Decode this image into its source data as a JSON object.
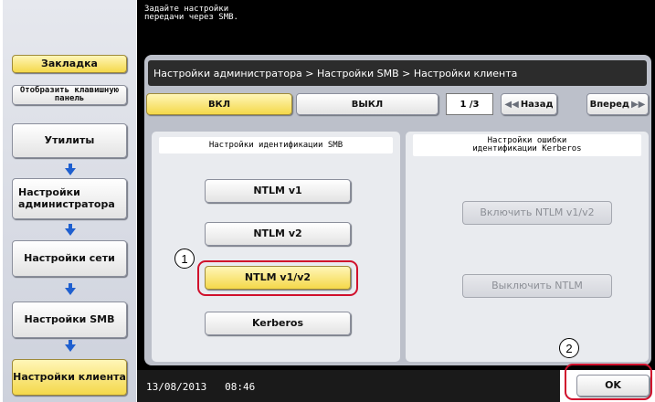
{
  "sidebar": {
    "bookmark": "Закладка",
    "show_keypad": "Отобразить клавишную панель",
    "steps": [
      "Утилиты",
      "Настройки администратора",
      "Настройки сети",
      "Настройки SMB",
      "Настройки клиента"
    ]
  },
  "message": "Задайте настройки\nпередачи через SMB.",
  "breadcrumb": "Настройки администратора > Настройки SMB > Настройки клиента",
  "toggle": {
    "on": "ВКЛ",
    "off": "ВЫКЛ"
  },
  "pager": {
    "indicator": "1 /3",
    "back": "Назад",
    "forward": "Вперед"
  },
  "auth_panel": {
    "title": "Настройки идентификации SMB",
    "options": [
      "NTLM v1",
      "NTLM v2",
      "NTLM v1/v2",
      "Kerberos"
    ],
    "selected": "NTLM v1/v2"
  },
  "kerberos_panel": {
    "title": "Настройки ошибки\nидентификации Kerberos",
    "enable_ntlm": "Включить NTLM v1/v2",
    "disable_ntlm": "Выключить NTLM"
  },
  "callouts": [
    "1",
    "2"
  ],
  "status": {
    "date": "13/08/2013",
    "time": "08:46"
  },
  "ok": "OK",
  "colors": {
    "selected": "#f4d84a",
    "highlight": "#d0102c",
    "arrow": "#1f5fcf"
  }
}
